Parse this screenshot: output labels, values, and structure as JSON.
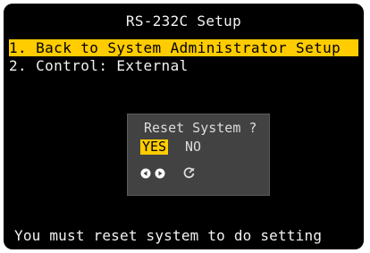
{
  "screen": {
    "title": "RS-232C Setup",
    "highlight_color": "#ffcc00"
  },
  "menu": {
    "items": [
      {
        "label": "1. Back to System Administrator Setup",
        "selected": true
      },
      {
        "label": "2. Control: External",
        "selected": false
      }
    ]
  },
  "dialog": {
    "title": "Reset System ?",
    "options": [
      {
        "label": "YES",
        "selected": true
      },
      {
        "label": "NO",
        "selected": false
      }
    ],
    "icons": [
      "left-arrow-icon",
      "right-arrow-icon",
      "enter-icon"
    ]
  },
  "footer": {
    "message": "You must reset system to do setting"
  }
}
